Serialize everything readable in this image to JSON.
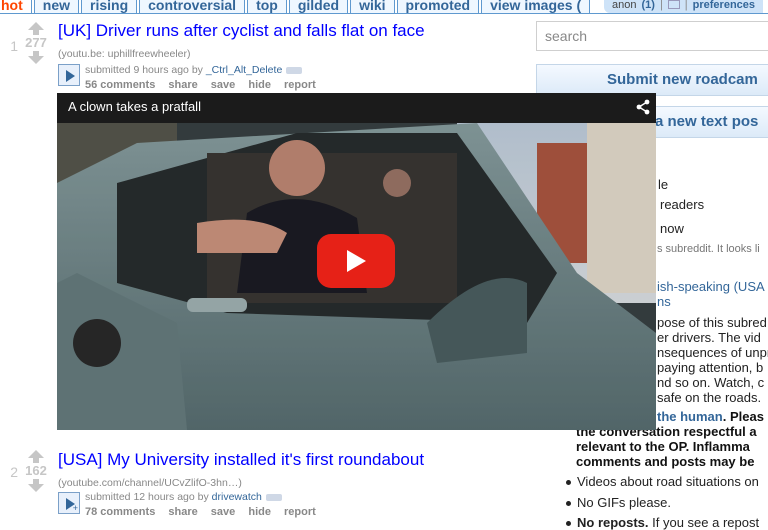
{
  "tabs": [
    "hot",
    "new",
    "rising",
    "controversial",
    "top",
    "gilded",
    "wiki",
    "promoted",
    "view images ("
  ],
  "user": {
    "name": "anon",
    "count": "(1)",
    "preferences": "preferences"
  },
  "posts": [
    {
      "rank": "1",
      "score": "277",
      "title": "[UK] Driver runs after cyclist and falls flat on face",
      "domain": "(youtu.be: uphillfreewheeler)",
      "submitted": "submitted 9 hours ago by ",
      "author": "_Ctrl_Alt_Delete",
      "comments": "56 comments",
      "share": "share",
      "save": "save",
      "hide": "hide",
      "report": "report",
      "expando_icon": "play-icon"
    },
    {
      "rank": "2",
      "score": "162",
      "title": "[USA] My University installed it's first roundabout",
      "domain": "(youtube.com/channel/UCvZlifO-3hn…)",
      "submitted": "submitted 12 hours ago by ",
      "author": "drivewatch",
      "comments": "78 comments",
      "share": "share",
      "save": "save",
      "hide": "hide",
      "report": "report",
      "expando_icon": "play-icon"
    }
  ],
  "video": {
    "title": "A clown takes a pratfall",
    "share_icon": "share-icon",
    "play_icon": "youtube-play-icon"
  },
  "sidebar": {
    "search_placeholder": "search",
    "submit_link": "Submit new roadcam",
    "submit_text": "a new text pos",
    "lines": [
      {
        "text": "le",
        "style": "s13"
      },
      {
        "text": "readers",
        "style": "s13"
      },
      {
        "text": "now",
        "style": "s13"
      },
      {
        "text": "s subreddit. It looks li",
        "style": "small"
      },
      {
        "text": "ish-speaking (USA",
        "style": "blue"
      },
      {
        "text": "ns",
        "style": "blue"
      },
      {
        "text": "pose of this subred",
        "style": "s13"
      },
      {
        "text": "er drivers. The vid",
        "style": "s13"
      },
      {
        "text": "nsequences of unpr",
        "style": "s13"
      },
      {
        "text": "paying attention, b",
        "style": "s13"
      },
      {
        "text": "nd so on. Watch, c",
        "style": "s13"
      },
      {
        "text": "safe on the roads.",
        "style": "s13"
      }
    ],
    "human_link": "the human",
    "human_rest": ". Pleas",
    "rules_bold": [
      "the conversation respectful a",
      "relevant to the OP. Inflamma",
      "comments and posts may be"
    ],
    "bullets": [
      "Videos about road situations on",
      "No GIFs please."
    ],
    "last_bold": "No reposts.",
    "last_rest": " If you see a repost"
  },
  "colors": {
    "link": "#0000ff",
    "tab_blue": "#369",
    "hot": "#ff4500",
    "yt_red": "#e62117"
  }
}
